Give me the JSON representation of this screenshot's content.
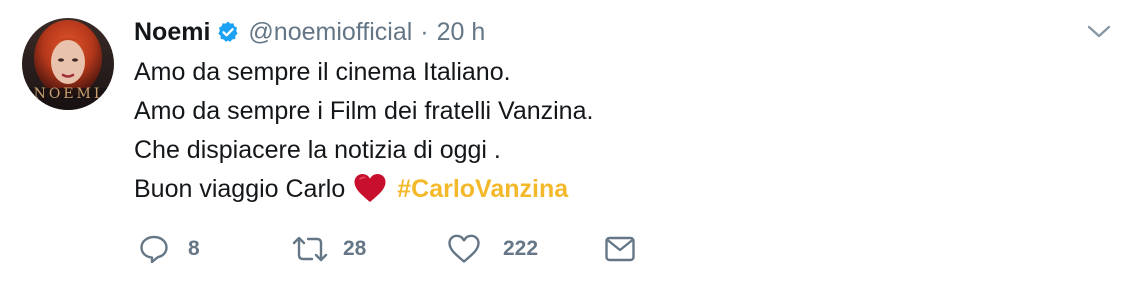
{
  "tweet": {
    "author_name": "Noemi",
    "handle": "@noemiofficial",
    "separator": "·",
    "time": "20 h",
    "lines": [
      "Amo da sempre il cinema Italiano.",
      "Amo da sempre i Film dei fratelli Vanzina.",
      "Che dispiacere la notizia di oggi .",
      "Buon viaggio Carlo"
    ],
    "hashtag": "#CarloVanzina",
    "avatar_text": "NOEMI",
    "emoji": "red-heart"
  },
  "actions": {
    "reply_count": "8",
    "retweet_count": "28",
    "like_count": "222"
  },
  "colors": {
    "text": "#14171a",
    "secondary": "#657786",
    "verified": "#1da1f2",
    "hashtag": "#f4b82b",
    "heart": "#c8102e"
  },
  "icons": [
    "verified-badge-icon",
    "chevron-down-icon",
    "reply-icon",
    "retweet-icon",
    "like-icon",
    "direct-message-icon"
  ]
}
